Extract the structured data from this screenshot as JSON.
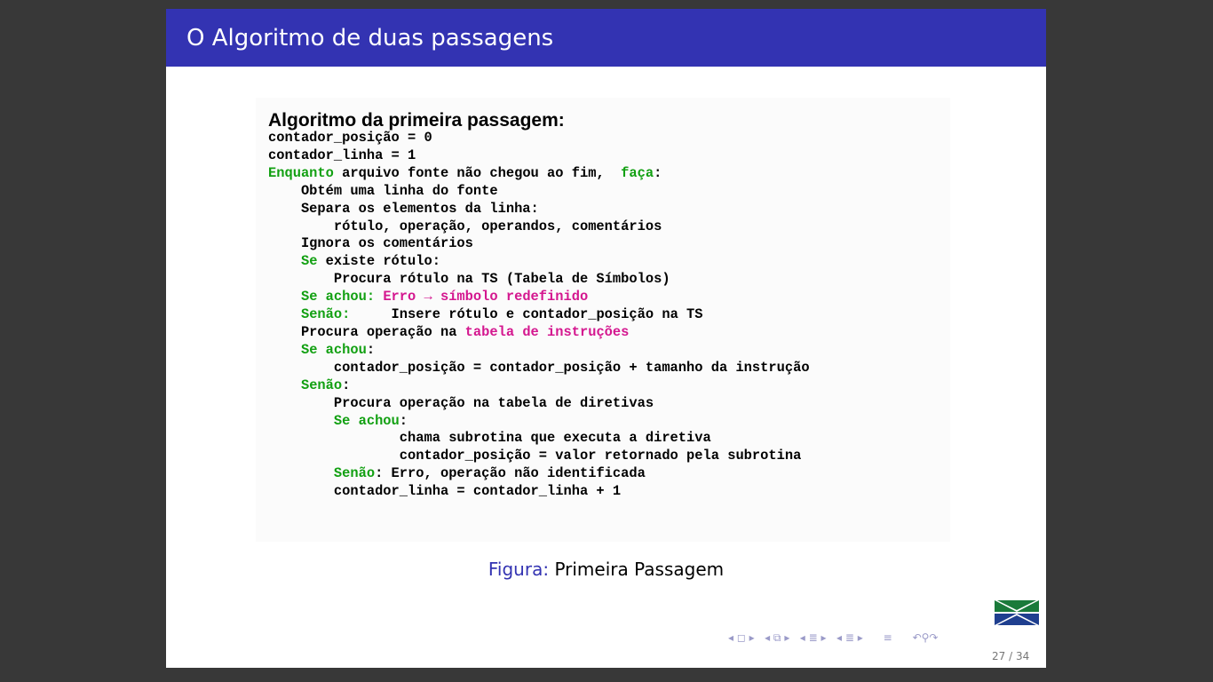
{
  "slide": {
    "title": "O Algoritmo de duas passagens"
  },
  "figure": {
    "heading": "Algoritmo da primeira passagem:",
    "lines": [
      [
        {
          "t": "contador_posição = 0",
          "c": ""
        }
      ],
      [
        {
          "t": "contador_linha = 1",
          "c": ""
        }
      ],
      [
        {
          "t": "Enquanto",
          "c": "kw"
        },
        {
          "t": " arquivo fonte não chegou ao fim,  ",
          "c": ""
        },
        {
          "t": "faça",
          "c": "kw"
        },
        {
          "t": ":",
          "c": ""
        }
      ],
      [
        {
          "t": "    Obtém uma linha do fonte",
          "c": ""
        }
      ],
      [
        {
          "t": "    Separa os elementos da linha:",
          "c": ""
        }
      ],
      [
        {
          "t": "        rótulo, operação, operandos, comentários",
          "c": ""
        }
      ],
      [
        {
          "t": "    Ignora os comentários",
          "c": ""
        }
      ],
      [
        {
          "t": "    ",
          "c": ""
        },
        {
          "t": "Se",
          "c": "kw"
        },
        {
          "t": " existe rótulo:",
          "c": ""
        }
      ],
      [
        {
          "t": "        Procura rótulo na TS (Tabela de Símbolos)",
          "c": ""
        }
      ],
      [
        {
          "t": "    ",
          "c": ""
        },
        {
          "t": "Se achou:",
          "c": "kw"
        },
        {
          "t": " Erro → símbolo redefinido",
          "c": "hl"
        }
      ],
      [
        {
          "t": "    ",
          "c": ""
        },
        {
          "t": "Senão:",
          "c": "kw"
        },
        {
          "t": "     Insere rótulo e contador_posição na TS",
          "c": ""
        }
      ],
      [
        {
          "t": "    Procura operação na ",
          "c": ""
        },
        {
          "t": "tabela de instruções",
          "c": "hl"
        }
      ],
      [
        {
          "t": "    ",
          "c": ""
        },
        {
          "t": "Se achou",
          "c": "kw"
        },
        {
          "t": ":",
          "c": ""
        }
      ],
      [
        {
          "t": "        contador_posição = contador_posição + tamanho da instrução",
          "c": ""
        }
      ],
      [
        {
          "t": "    ",
          "c": ""
        },
        {
          "t": "Senão",
          "c": "kw"
        },
        {
          "t": ":",
          "c": ""
        }
      ],
      [
        {
          "t": "        Procura operação na tabela de diretivas",
          "c": ""
        }
      ],
      [
        {
          "t": "        ",
          "c": ""
        },
        {
          "t": "Se achou",
          "c": "kw"
        },
        {
          "t": ":",
          "c": ""
        }
      ],
      [
        {
          "t": "                chama subrotina que executa a diretiva",
          "c": ""
        }
      ],
      [
        {
          "t": "                contador_posição = valor retornado pela subrotina",
          "c": ""
        }
      ],
      [
        {
          "t": "        ",
          "c": ""
        },
        {
          "t": "Senão",
          "c": "kw"
        },
        {
          "t": ": Erro, operação não identificada",
          "c": ""
        }
      ],
      [
        {
          "t": "        contador_linha = contador_linha + 1",
          "c": ""
        }
      ]
    ],
    "caption_label": "Figura:",
    "caption_text": "Primeira Passagem"
  },
  "colors": {
    "title_bar": "#3333b2",
    "keyword": "#12a012",
    "highlight": "#d4178f"
  },
  "navigation": {
    "icons": [
      "nav-frame-icon",
      "nav-subsection-icon",
      "nav-section-icon",
      "nav-section2-icon",
      "nav-align-icon",
      "nav-search-icon"
    ]
  },
  "page": {
    "number": "27 / 34"
  }
}
